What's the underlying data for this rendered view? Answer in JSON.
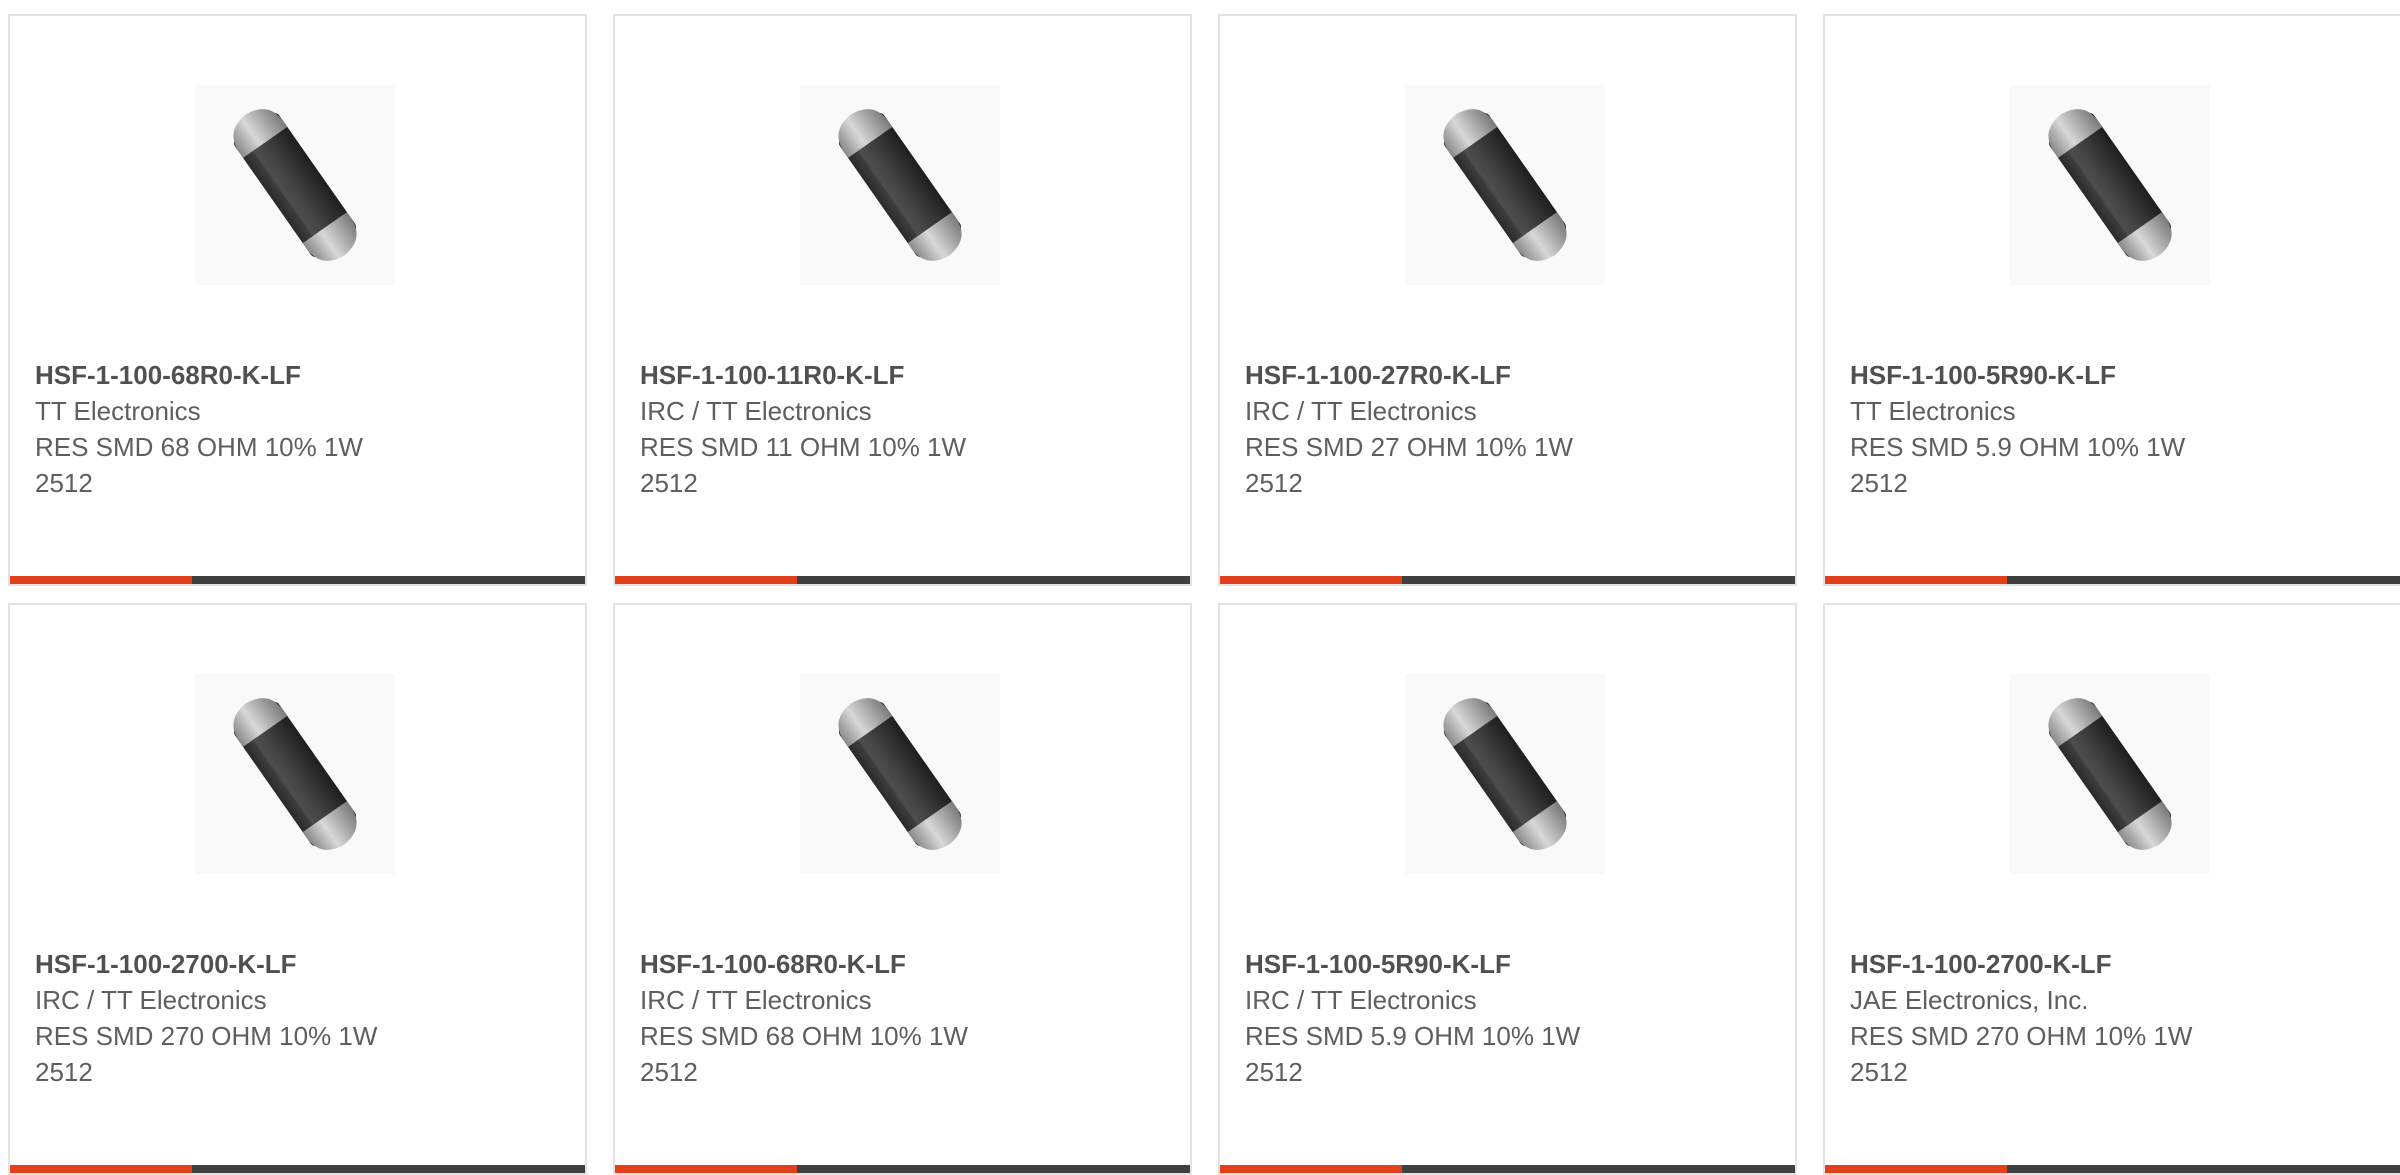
{
  "colors": {
    "accent": "#e2401b",
    "bar_dark": "#3f3f3f",
    "card_border": "#e3e3e3",
    "text": "#5e5e5e"
  },
  "cards": [
    {
      "part_number": "HSF-1-100-68R0-K-LF",
      "manufacturer": "TT Electronics",
      "description": "RES SMD 68 OHM 10% 1W 2512",
      "image_icon": "resistor-image"
    },
    {
      "part_number": "HSF-1-100-11R0-K-LF",
      "manufacturer": "IRC / TT Electronics",
      "description": "RES SMD 11 OHM 10% 1W 2512",
      "image_icon": "resistor-image"
    },
    {
      "part_number": "HSF-1-100-27R0-K-LF",
      "manufacturer": "IRC / TT Electronics",
      "description": "RES SMD 27 OHM 10% 1W 2512",
      "image_icon": "resistor-image"
    },
    {
      "part_number": "HSF-1-100-5R90-K-LF",
      "manufacturer": "TT Electronics",
      "description": "RES SMD 5.9 OHM 10% 1W 2512",
      "image_icon": "resistor-image"
    },
    {
      "part_number": "HSF-1-100-2700-K-LF",
      "manufacturer": "IRC / TT Electronics",
      "description": "RES SMD 270 OHM 10% 1W 2512",
      "image_icon": "resistor-image"
    },
    {
      "part_number": "HSF-1-100-68R0-K-LF",
      "manufacturer": "IRC / TT Electronics",
      "description": "RES SMD 68 OHM 10% 1W 2512",
      "image_icon": "resistor-image"
    },
    {
      "part_number": "HSF-1-100-5R90-K-LF",
      "manufacturer": "IRC / TT Electronics",
      "description": "RES SMD 5.9 OHM 10% 1W 2512",
      "image_icon": "resistor-image"
    },
    {
      "part_number": "HSF-1-100-2700-K-LF",
      "manufacturer": "JAE Electronics, Inc.",
      "description": "RES SMD 270 OHM 10% 1W 2512",
      "image_icon": "resistor-image"
    }
  ]
}
